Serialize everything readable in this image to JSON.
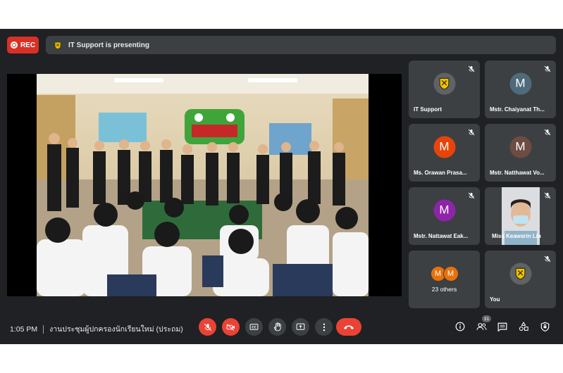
{
  "recording": {
    "label": "REC"
  },
  "presenting_banner": {
    "text": "IT Support is presenting"
  },
  "participants": [
    {
      "name": "IT Support",
      "avatar": "crest",
      "muted": true
    },
    {
      "name": "Mstr. Chaiyanat Th...",
      "initial": "M",
      "avatar_color": "#4e6b7b",
      "muted": true
    },
    {
      "name": "Ms. Orawan Prasa...",
      "initial": "M",
      "avatar_color": "#e8440a",
      "muted": true
    },
    {
      "name": "Mstr. Natthawat Vo...",
      "initial": "M",
      "avatar_color": "#6d4c41",
      "muted": true
    },
    {
      "name": "Mstr. Nattawat Eak...",
      "initial": "M",
      "avatar_color": "#8e24aa",
      "muted": true
    },
    {
      "name": "Miss Keawarin Lin",
      "video": true,
      "muted": true
    }
  ],
  "others": {
    "initials": [
      "M",
      "M"
    ],
    "label": "23 others"
  },
  "self": {
    "name": "You",
    "avatar": "crest",
    "muted": true
  },
  "bottom_bar": {
    "time": "1:05 PM",
    "meeting_title": "งานประชุมผู้ปกครองนักเรียนใหม่ (ประถม)",
    "people_count": "31"
  },
  "controls": [
    "mic-off-icon",
    "camera-off-icon",
    "captions-icon",
    "raise-hand-icon",
    "present-icon",
    "more-options-icon",
    "end-call-icon"
  ],
  "right_controls": [
    "info-icon",
    "people-icon",
    "chat-icon",
    "activities-icon",
    "host-controls-icon"
  ],
  "colors": {
    "background": "#202124",
    "tile": "#3c4043",
    "red": "#ea4335",
    "rec": "#d93025"
  }
}
